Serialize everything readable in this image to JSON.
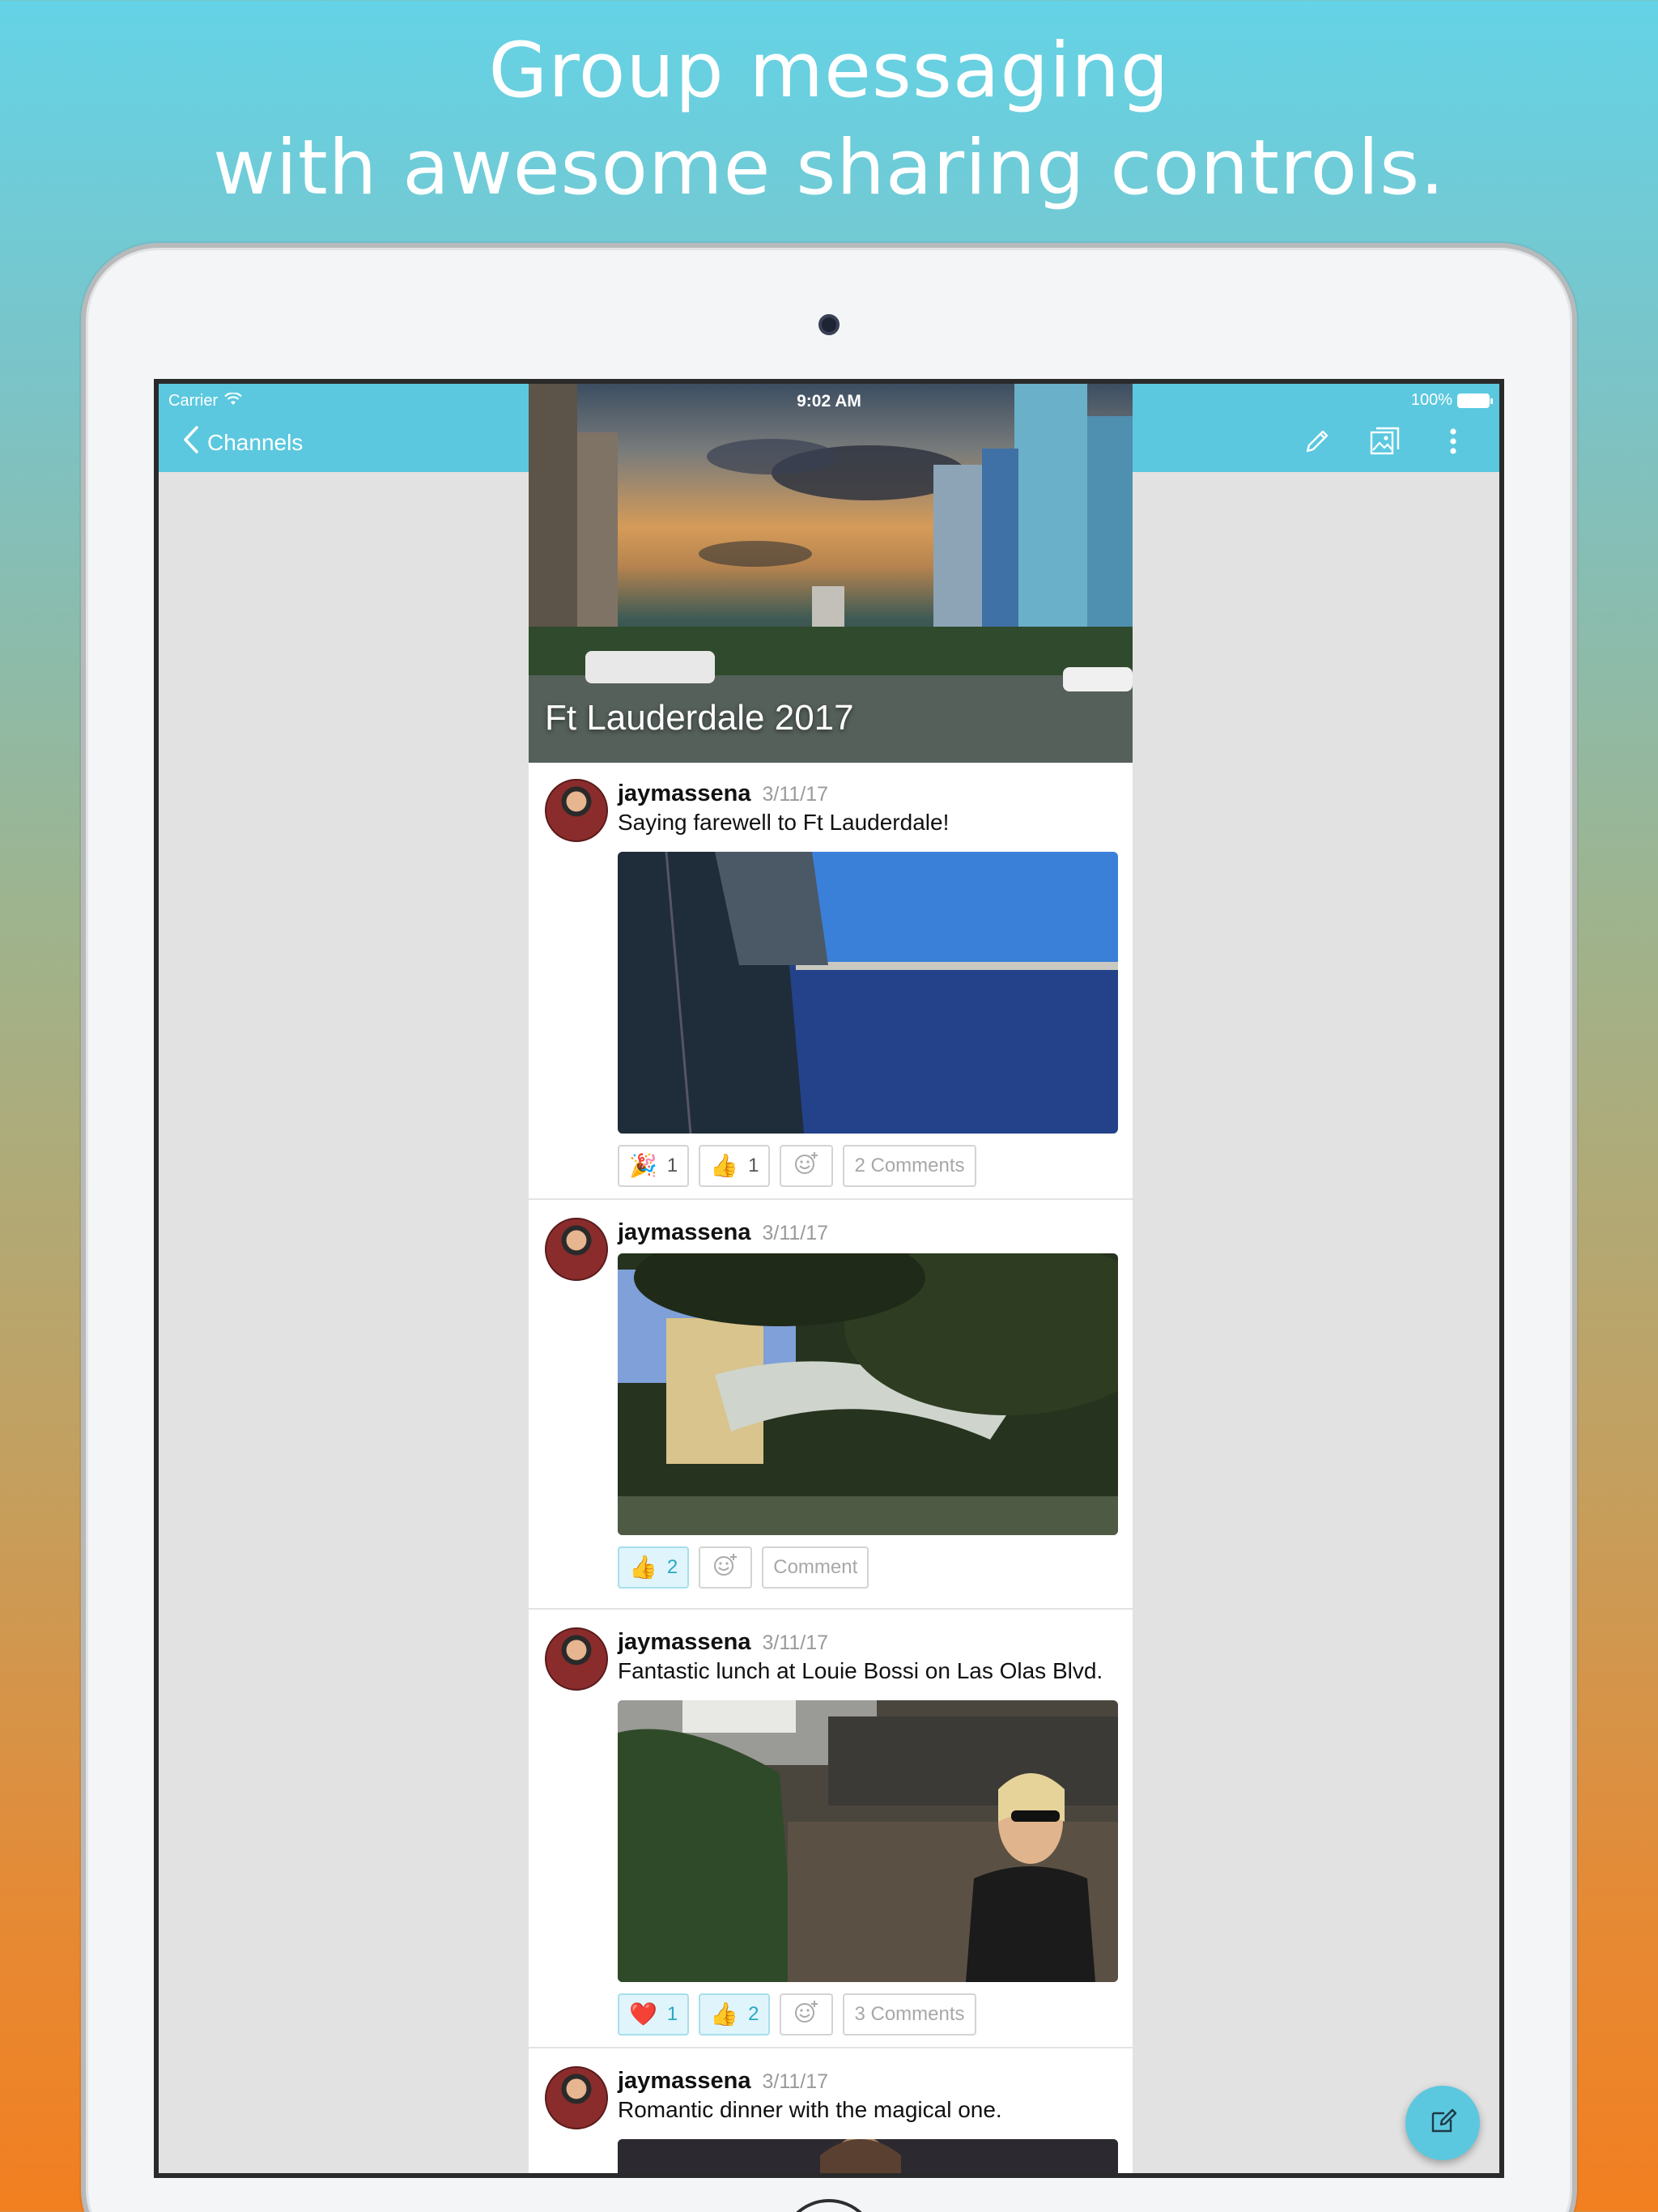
{
  "headline": {
    "line1": "Group messaging",
    "line2": "with awesome sharing controls."
  },
  "status_bar": {
    "carrier": "Carrier",
    "time": "9:02 AM",
    "battery": "100%"
  },
  "navbar": {
    "back_label": "Channels",
    "actions": [
      "pencil-icon",
      "gallery-icon",
      "more-vertical-icon"
    ]
  },
  "channel": {
    "title": "Ft Lauderdale 2017"
  },
  "posts": [
    {
      "username": "jaymassena",
      "date": "3/11/17",
      "caption": "Saying farewell to Ft Lauderdale!",
      "photo": "ship-side-and-waterfront-photo",
      "reactions": [
        {
          "emoji": "🎉",
          "count": "1",
          "active": false
        },
        {
          "emoji": "👍",
          "count": "1",
          "active": false
        }
      ],
      "comments_label": "2 Comments"
    },
    {
      "username": "jaymassena",
      "date": "3/11/17",
      "caption": "",
      "photo": "park-pavilion-and-trees-photo",
      "reactions": [
        {
          "emoji": "👍",
          "count": "2",
          "active": true
        }
      ],
      "comments_label": "Comment"
    },
    {
      "username": "jaymassena",
      "date": "3/11/17",
      "caption": "Fantastic lunch at Louie Bossi on Las Olas Blvd.",
      "photo": "outdoor-restaurant-woman-photo",
      "reactions": [
        {
          "emoji": "❤️",
          "count": "1",
          "active": true
        },
        {
          "emoji": "👍",
          "count": "2",
          "active": true
        }
      ],
      "comments_label": "3 Comments"
    },
    {
      "username": "jaymassena",
      "date": "3/11/17",
      "caption": "Romantic dinner with the magical one.",
      "photo": "dinner-photo",
      "reactions": [],
      "comments_label": ""
    }
  ],
  "colors": {
    "accent": "#5bc8df",
    "reaction_active_bg": "#dff5fb",
    "gradient_top": "#64d3e6",
    "gradient_bottom": "#f27f20"
  }
}
